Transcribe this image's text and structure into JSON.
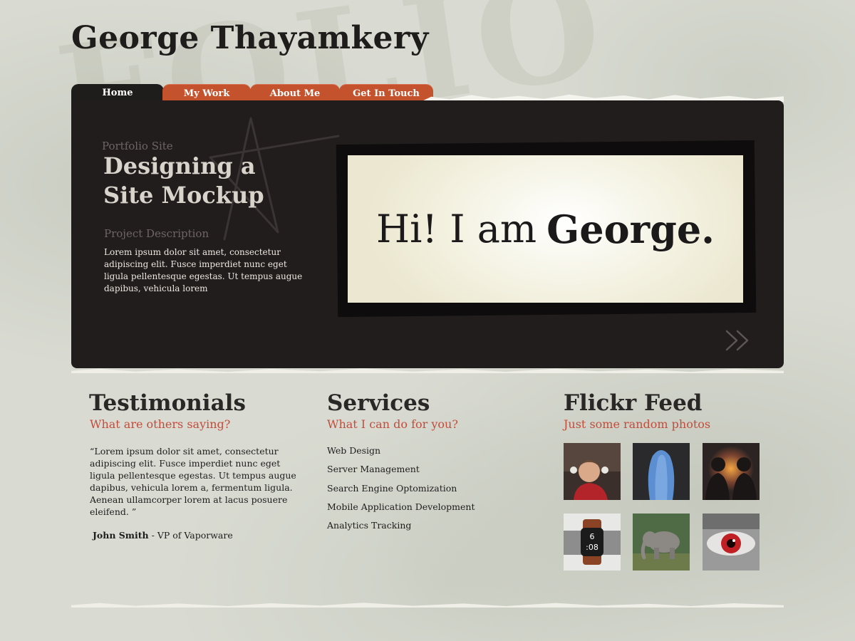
{
  "header": {
    "title": "George Thayamkery"
  },
  "nav": {
    "tabs": [
      {
        "label": "Home",
        "active": true
      },
      {
        "label": "My Work",
        "active": false
      },
      {
        "label": "About Me",
        "active": false
      },
      {
        "label": "Get In Touch",
        "active": false
      }
    ]
  },
  "hero": {
    "kicker": "Portfolio Site",
    "title_line1": "Designing a",
    "title_line2": "Site Mockup",
    "description_label": "Project Description",
    "description": "Lorem ipsum dolor sit amet, consectetur adipiscing elit. Fusce imperdiet nunc eget ligula pellentesque egestas. Ut tempus augue dapibus, vehicula lorem",
    "screen_text_regular": "Hi! I am",
    "screen_text_bold": "George."
  },
  "testimonials": {
    "title": "Testimonials",
    "subtitle": "What are others saying?",
    "quote": "“Lorem ipsum dolor sit amet, consectetur adipiscing elit. Fusce imperdiet nunc eget ligula pellentesque egestas. Ut tempus augue dapibus, vehicula lorem a, fermentum ligula. Aenean ullamcorper lorem at lacus posuere eleifend. ”",
    "author_name": "John Smith",
    "author_role": " - VP of Vaporware"
  },
  "services": {
    "title": "Services",
    "subtitle": "What I can do for you?",
    "items": [
      "Web Design",
      "Server Management",
      "Search Engine Optomization",
      "Mobile Application Development",
      "Analytics Tracking"
    ]
  },
  "flickr": {
    "title": "Flickr Feed",
    "subtitle": "Just some random photos",
    "photos": [
      {
        "subject": "child-in-red-jacket"
      },
      {
        "subject": "blue-haired-person"
      },
      {
        "subject": "two-men-at-sunset"
      },
      {
        "subject": "smartwatch-on-wrist",
        "watch_time_hour": "6",
        "watch_time_minute": ":08"
      },
      {
        "subject": "elephant"
      },
      {
        "subject": "red-eye-closeup"
      }
    ]
  },
  "colors": {
    "background": "#d9dbd2",
    "hero_background": "#211d1d",
    "tab_accent": "#c4532d",
    "subtitle_accent": "#c14d3c",
    "title_text": "#1f1d1c"
  }
}
